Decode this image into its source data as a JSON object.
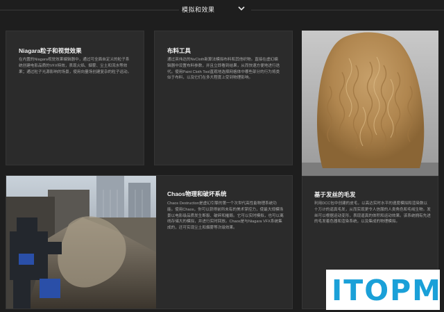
{
  "header": {
    "title": "模拟和效果"
  },
  "cards": [
    {
      "title": "Niagara粒子和视觉效果",
      "body": "在内置的Niagara视觉效果编辑器中，通过可全面自定义的粒子系统创建电影品质的VFX特效，表现火焰、烟雾、尘土和流水等效果；通过粒子光源影响的场景，使用向量场创建复杂的粒子运动。"
    },
    {
      "title": "布料工具",
      "body": "通过英伟达的NvCloth新算法模拟布料和其他织物。直接在虚幻编辑器中设置布料参数，并且立即看到结果，从而快速方便地进行迭代。使用Paint Cloth Tool直观地选择网格体中哪些部分的行为将类似于布料，以及它们在多大程度上受到物理影响。"
    },
    {
      "title": "Chaos物理和破坏系统",
      "body": "Chaos Destruction是虚幻引擎的第一个次世代高性能物理系统功能。使用Chaos，你可以获得前所未有的美术掌控力，使最大规模场景以电影级品质发生断裂、破碎和摧毁。它可以实时模拟，也可以离线存储大的模拟，并进行实时回放。Chaos是与Niagara VFX系统集成的，还可实现尘土和烟雾等次级效果。"
    },
    {
      "title": "基于发丝的毛发",
      "body": "利用DCC包中创建的皮毛，以高达实时水平的速度模拟和渲染数以十万计的逼真毛发，从而实现更令人信服的人类角色和毛绒生物。发丝可以根据运动变形，表现逼真的体积和运动效果。该系统拥有先进的毛发着色器和渲染系统，以及集成的物理模拟。"
    }
  ],
  "icons": {
    "header_chevron": "chevron-down-icon"
  },
  "watermark": {
    "text": "ITOPM",
    "color": "#1aa0d8"
  },
  "colors": {
    "background": "#1e1e1e",
    "card": "#2b2b2b",
    "title": "#f2f2f2",
    "body": "#a9a9a9"
  }
}
